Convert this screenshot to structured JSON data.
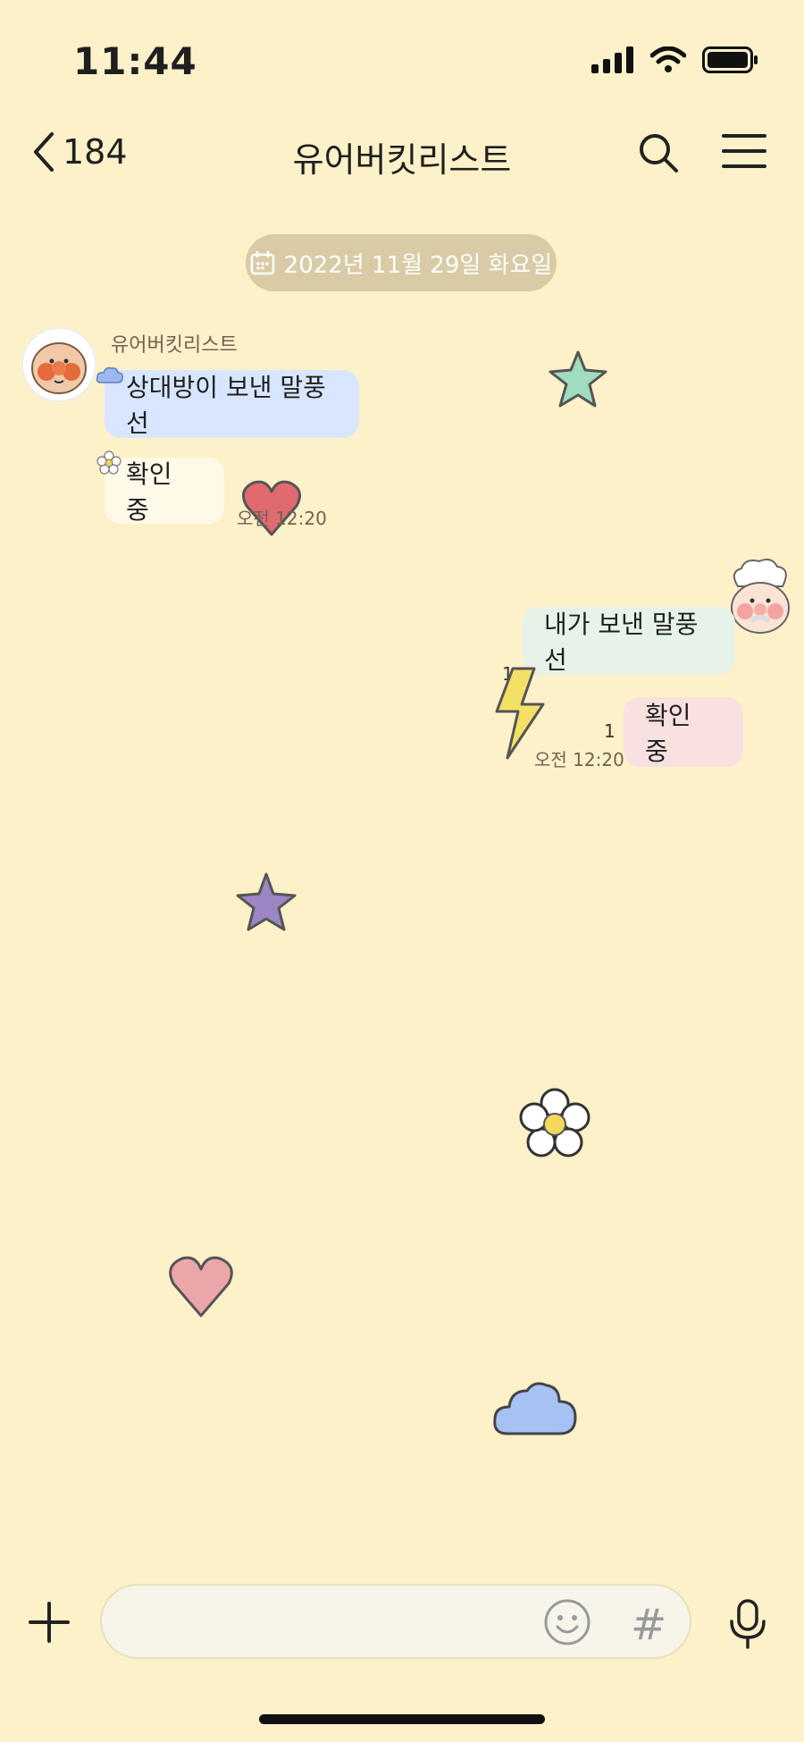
{
  "status_bar": {
    "time": "11:44"
  },
  "header": {
    "back_count": "184",
    "title": "유어버킷리스트"
  },
  "date_chip": {
    "label": "2022년 11월 29일 화요일"
  },
  "incoming": {
    "sender": "유어버킷리스트",
    "messages": [
      "상대방이 보낸 말풍선",
      "확인 중"
    ],
    "timestamp": "오전 12:20"
  },
  "outgoing": {
    "messages": [
      "내가 보낸 말풍선",
      "확인 중"
    ],
    "unread_1": "1",
    "unread_2": "1",
    "timestamp": "오전 12:20"
  },
  "input": {
    "hash_label": "#"
  },
  "colors": {
    "background": "#fdf1c9",
    "incoming_bubble_1": "#d8e7ff",
    "incoming_bubble_2": "#fff9e8",
    "outgoing_bubble_1": "#e7f3e8",
    "outgoing_bubble_2": "#f8e1e0"
  }
}
